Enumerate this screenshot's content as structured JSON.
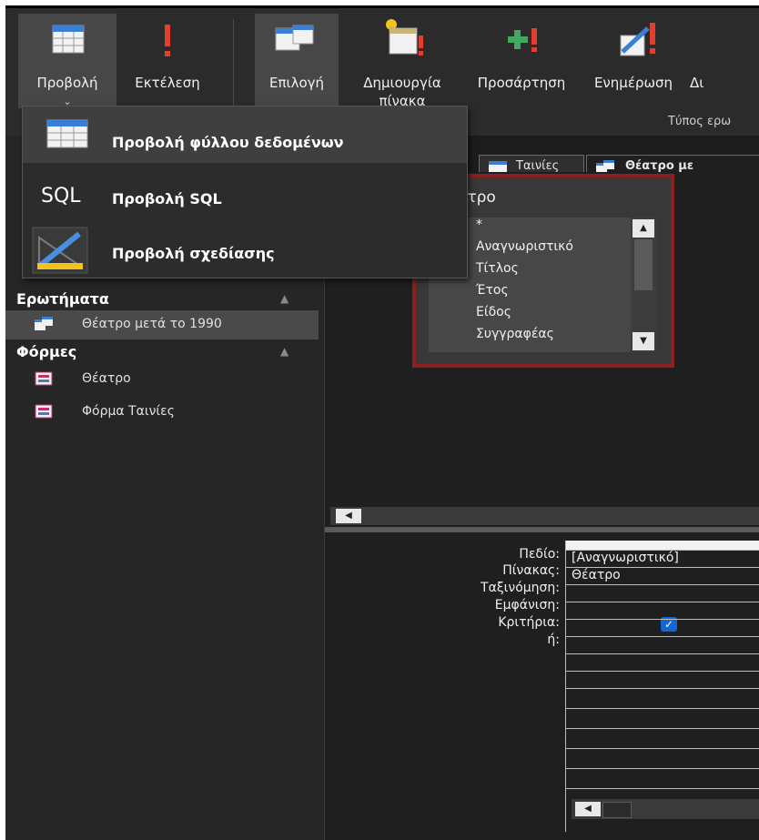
{
  "ribbon": {
    "buttons": [
      {
        "label": "Προβολή",
        "chevron": "⌄",
        "icon": "datasheet-view-icon"
      },
      {
        "label": "Εκτέλεση",
        "icon": "run-exclamation-icon"
      },
      {
        "label": "Επιλογή",
        "icon": "select-query-icon"
      },
      {
        "label": "Δημιουργία",
        "label2": "πίνακα",
        "icon": "make-table-icon"
      },
      {
        "label": "Προσάρτηση",
        "icon": "append-query-icon"
      },
      {
        "label": "Ενημέρωση",
        "icon": "update-query-icon"
      },
      {
        "label": "Δι",
        "icon": ""
      }
    ],
    "group_label": "Τύπος ερω"
  },
  "view_menu": {
    "items": [
      {
        "label": "Προβολή φύλλου δεδομένων",
        "icon": "datasheet-view-icon"
      },
      {
        "label": "Προβολή SQL",
        "icon_text": "SQL"
      },
      {
        "label": "Προβολή σχεδίασης",
        "icon": "design-view-icon"
      }
    ]
  },
  "nav": {
    "sections": [
      {
        "title": "Ερωτήματα",
        "items": [
          "Θέατρο μετά το 1990"
        ]
      },
      {
        "title": "Φόρμες",
        "items": [
          "Θέατρο",
          "Φόρμα Ταινίες"
        ]
      }
    ]
  },
  "tabs": [
    {
      "label": "Ταινίες"
    },
    {
      "label": "Θέατρο με"
    }
  ],
  "field_list": {
    "title": "έατρο",
    "fields": [
      "*",
      "Αναγνωριστικό",
      "Τίτλος",
      "Έτος",
      "Είδος",
      "Συγγραφέας"
    ]
  },
  "grid": {
    "row_labels": [
      "Πεδίο:",
      "Πίνακας:",
      "Ταξινόμηση:",
      "Εμφάνιση:",
      "Κριτήρια:",
      "ή:"
    ],
    "column1": {
      "field": "[Αναγνωριστικό]",
      "table": "Θέατρο",
      "show": true
    }
  },
  "colors": {
    "fieldlist_border": "#8b2020",
    "checkbox": "#1366d6",
    "selected_nav": "#4a4a4a"
  }
}
